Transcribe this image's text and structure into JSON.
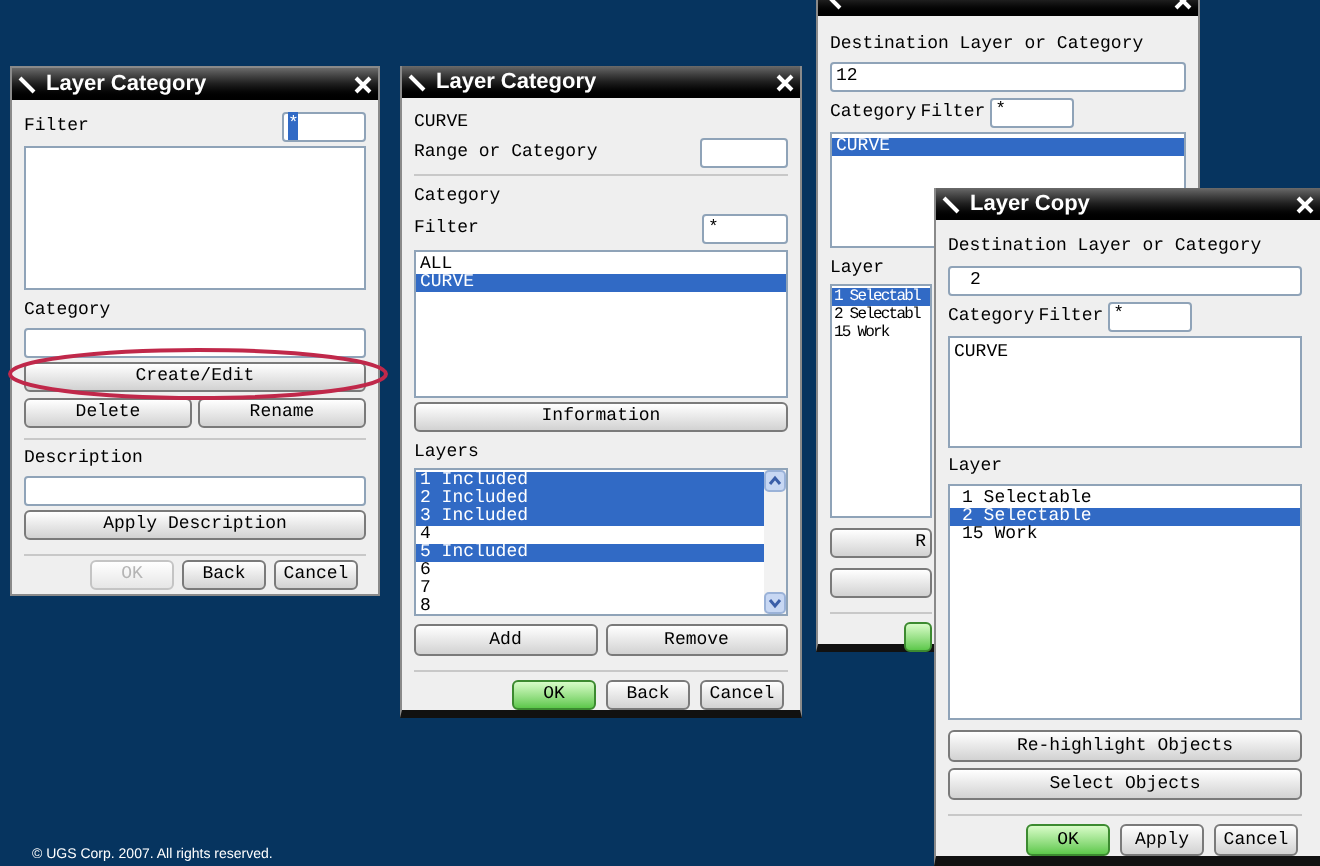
{
  "layer_category_1": {
    "title": "Layer Category",
    "filter": {
      "label": "Filter",
      "value": "*",
      "value_highlighted": true
    },
    "category": {
      "label": "Category"
    },
    "buttons": [
      "Create/Edit",
      "Delete",
      "Rename"
    ],
    "description": {
      "label": "Description"
    },
    "apply_button": "Apply Description",
    "footer": [
      {
        "label": "OK",
        "disabled": true,
        "default": false
      },
      {
        "label": "Back",
        "disabled": false,
        "default": false
      },
      {
        "label": "Cancel",
        "disabled": false,
        "default": false
      }
    ]
  },
  "layer_category_2": {
    "title": "Layer Category",
    "category_name": "CURVE",
    "range": {
      "label": "Range or Category"
    },
    "section_label": "Category",
    "filter": {
      "label": "Filter",
      "value": "*"
    },
    "categories": [
      {
        "label": "ALL",
        "selected": false
      },
      {
        "label": "CURVE",
        "selected": true
      }
    ],
    "info_button": "Information",
    "layers_label": "Layers",
    "layers": [
      {
        "label": "1 Included",
        "selected": true
      },
      {
        "label": "2 Included",
        "selected": true
      },
      {
        "label": "3 Included",
        "selected": true
      },
      {
        "label": "4",
        "selected": false
      },
      {
        "label": "5 Included",
        "selected": true
      },
      {
        "label": "6",
        "selected": false
      },
      {
        "label": "7",
        "selected": false
      },
      {
        "label": "8",
        "selected": false
      }
    ],
    "action_buttons": [
      "Add",
      "Remove"
    ],
    "footer": [
      {
        "label": "OK",
        "disabled": false,
        "default": true
      },
      {
        "label": "Back",
        "disabled": false,
        "default": false
      },
      {
        "label": "Cancel",
        "disabled": false,
        "default": false
      }
    ]
  },
  "layer_move": {
    "destination": {
      "label": "Destination Layer or Category",
      "value": "12"
    },
    "category_label": "Category",
    "filter": {
      "label": "Filter",
      "value": "*"
    },
    "categories": [
      {
        "label": "CURVE",
        "selected": true
      }
    ],
    "layer_label": "Layer",
    "layers": [
      {
        "label": "1 Selectabl",
        "selected": true
      },
      {
        "label": "2 Selectabl",
        "selected": false
      },
      {
        "label": "15 Work",
        "selected": false
      }
    ],
    "buttons": [
      "R"
    ]
  },
  "layer_copy": {
    "title": "Layer Copy",
    "destination": {
      "label": "Destination Layer or Category",
      "value": "2"
    },
    "category_label": "Category",
    "filter": {
      "label": "Filter",
      "value": "*"
    },
    "categories": [
      {
        "label": "CURVE",
        "selected": false
      }
    ],
    "layer_label": "Layer",
    "layers": [
      {
        "label": "1 Selectable",
        "selected": false
      },
      {
        "label": "2 Selectable",
        "selected": true
      },
      {
        "label": "15 Work",
        "selected": false
      }
    ],
    "buttons": [
      "Re-highlight Objects",
      "Select Objects"
    ],
    "footer": [
      {
        "label": "OK",
        "disabled": false,
        "default": true
      },
      {
        "label": "Apply",
        "disabled": false,
        "default": false
      },
      {
        "label": "Cancel",
        "disabled": false,
        "default": false
      }
    ]
  },
  "copyright": "© UGS Corp. 2007. All rights reserved."
}
